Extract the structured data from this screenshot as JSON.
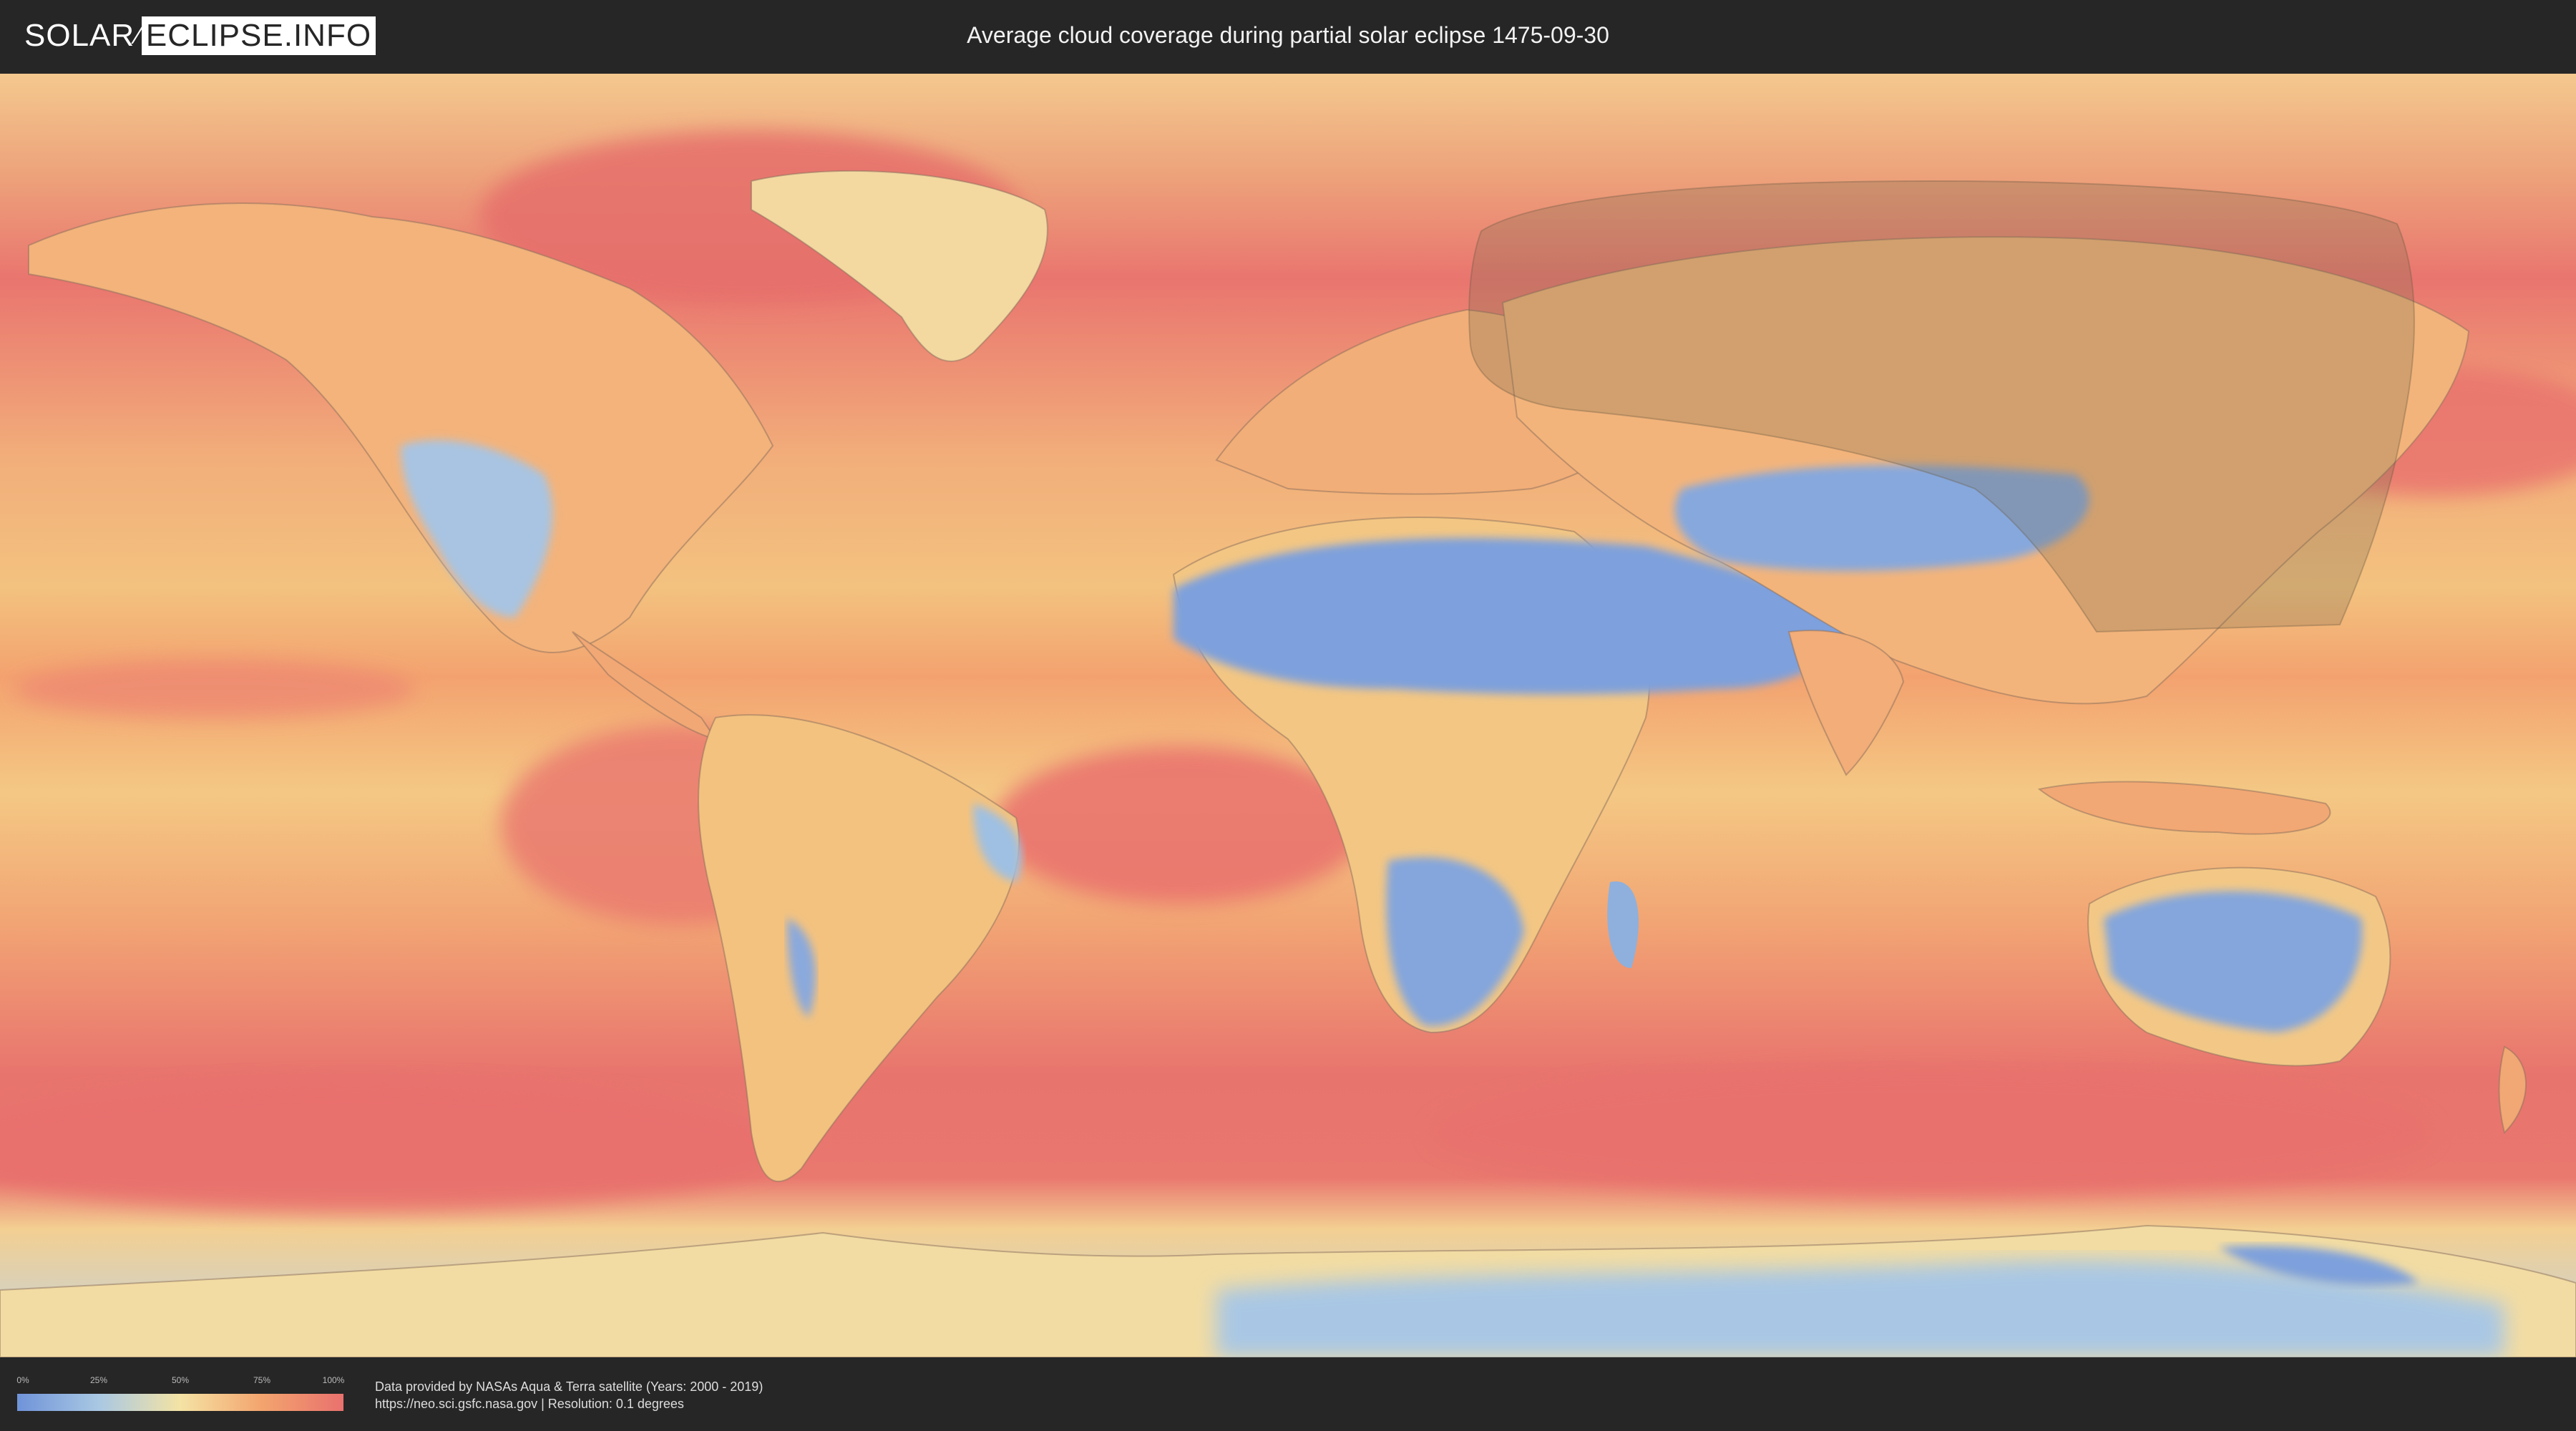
{
  "header": {
    "logo_left": "SOLAR",
    "logo_right": "ECLIPSE.INFO",
    "title": "Average cloud coverage during partial solar eclipse 1475-09-30"
  },
  "map": {
    "type": "world-cloud-coverage",
    "eclipse_date": "1475-09-30",
    "eclipse_type": "partial",
    "visibility_region": "northeast Asia (shaded overlay)",
    "colors": {
      "ocean_cloudy": "#e9716e",
      "medium": "#f3a46e",
      "light": "#f4e3a4",
      "clear": "#6f93d9",
      "eclipse_shade": "#7a6a50"
    }
  },
  "legend": {
    "ticks": [
      "0%",
      "25%",
      "50%",
      "75%",
      "100%"
    ],
    "colors": [
      "#6f93d9",
      "#a9c8e3",
      "#f4e3a4",
      "#f3a46e",
      "#e9716e"
    ]
  },
  "footer": {
    "credit_line1": "Data provided by NASAs Aqua & Terra satellite (Years: 2000 - 2019)",
    "credit_line2": "https://neo.sci.gsfc.nasa.gov | Resolution: 0.1 degrees"
  }
}
